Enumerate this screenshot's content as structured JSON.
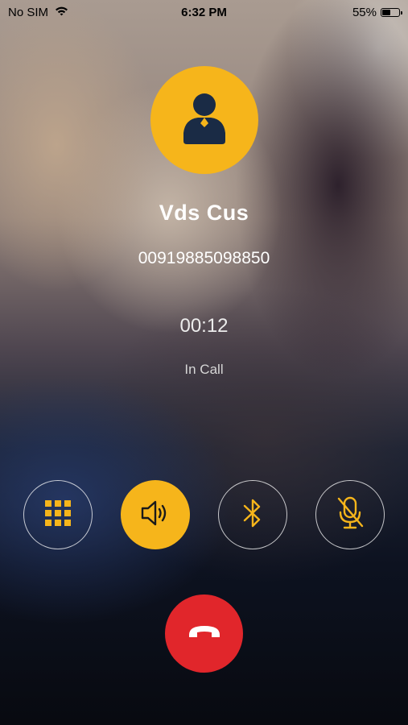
{
  "status_bar": {
    "carrier": "No SIM",
    "time": "6:32 PM",
    "battery_percent": "55%",
    "battery_level": 0.55,
    "wifi_icon": "wifi-icon",
    "battery_icon": "battery-icon"
  },
  "contact": {
    "name": "Vds Cus",
    "number": "00919885098850",
    "avatar_icon": "person-icon"
  },
  "call": {
    "duration": "00:12",
    "status": "In Call"
  },
  "controls": [
    {
      "icon": "keypad-icon",
      "active": false
    },
    {
      "icon": "speaker-icon",
      "active": true
    },
    {
      "icon": "bluetooth-icon",
      "active": false
    },
    {
      "icon": "mute-microphone-icon",
      "active": false
    }
  ],
  "end_call_icon": "hang-up-icon",
  "colors": {
    "accent": "#f6b51b",
    "end_call": "#e1262b",
    "avatar_glyph": "#1a2b45"
  }
}
